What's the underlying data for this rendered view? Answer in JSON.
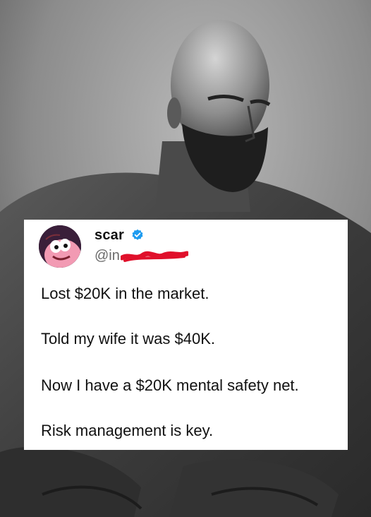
{
  "post": {
    "display_name": "scar",
    "handle": "@in",
    "lines": [
      "Lost $20K in the market.",
      "Told my wife it was $40K.",
      "Now I have a $20K mental safety net.",
      "Risk management is key."
    ]
  },
  "icons": {
    "verified": "verified-badge-icon",
    "avatar": "cartoon-avatar"
  },
  "colors": {
    "verified_blue": "#1d9bf0",
    "redaction_red": "#e0102b"
  }
}
